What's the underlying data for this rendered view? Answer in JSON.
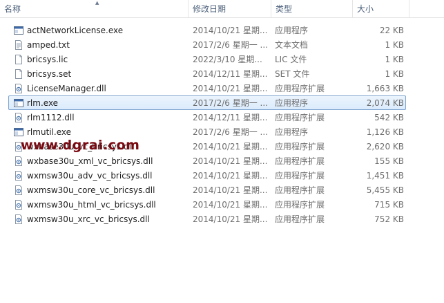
{
  "columns": {
    "name": "名称",
    "date": "修改日期",
    "type": "类型",
    "size": "大小"
  },
  "files": [
    {
      "name": "actNetworkLicense.exe",
      "date": "2014/10/21 星期...",
      "type": "应用程序",
      "size": "22 KB",
      "icon": "exe-icon"
    },
    {
      "name": "amped.txt",
      "date": "2017/2/6 星期一 ...",
      "type": "文本文档",
      "size": "1 KB",
      "icon": "text-file-icon"
    },
    {
      "name": "bricsys.lic",
      "date": "2022/3/10 星期...",
      "type": "LIC 文件",
      "size": "1 KB",
      "icon": "blank-file-icon"
    },
    {
      "name": "bricsys.set",
      "date": "2014/12/11 星期...",
      "type": "SET 文件",
      "size": "1 KB",
      "icon": "blank-file-icon"
    },
    {
      "name": "LicenseManager.dll",
      "date": "2014/10/21 星期...",
      "type": "应用程序扩展",
      "size": "1,663 KB",
      "icon": "dll-icon"
    },
    {
      "name": "rlm.exe",
      "date": "2017/2/6 星期一 ...",
      "type": "应用程序",
      "size": "2,074 KB",
      "icon": "exe-icon",
      "selected": true
    },
    {
      "name": "rlm1112.dll",
      "date": "2014/12/11 星期...",
      "type": "应用程序扩展",
      "size": "542 KB",
      "icon": "dll-icon"
    },
    {
      "name": "rlmutil.exe",
      "date": "2017/2/6 星期一 ...",
      "type": "应用程序",
      "size": "1,126 KB",
      "icon": "exe-icon"
    },
    {
      "name": "wxbase30u_vc_bricsys.dll",
      "date": "2014/10/21 星期...",
      "type": "应用程序扩展",
      "size": "2,620 KB",
      "icon": "dll-icon"
    },
    {
      "name": "wxbase30u_xml_vc_bricsys.dll",
      "date": "2014/10/21 星期...",
      "type": "应用程序扩展",
      "size": "155 KB",
      "icon": "dll-icon"
    },
    {
      "name": "wxmsw30u_adv_vc_bricsys.dll",
      "date": "2014/10/21 星期...",
      "type": "应用程序扩展",
      "size": "1,451 KB",
      "icon": "dll-icon"
    },
    {
      "name": "wxmsw30u_core_vc_bricsys.dll",
      "date": "2014/10/21 星期...",
      "type": "应用程序扩展",
      "size": "5,455 KB",
      "icon": "dll-icon"
    },
    {
      "name": "wxmsw30u_html_vc_bricsys.dll",
      "date": "2014/10/21 星期...",
      "type": "应用程序扩展",
      "size": "715 KB",
      "icon": "dll-icon"
    },
    {
      "name": "wxmsw30u_xrc_vc_bricsys.dll",
      "date": "2014/10/21 星期...",
      "type": "应用程序扩展",
      "size": "752 KB",
      "icon": "dll-icon"
    }
  ],
  "watermark": "www.dgrai.com",
  "colors": {
    "header_text": "#4c607a",
    "selection_border": "#7da2ce",
    "selection_fill": "#dbebfc",
    "watermark": "#7a0a12"
  }
}
